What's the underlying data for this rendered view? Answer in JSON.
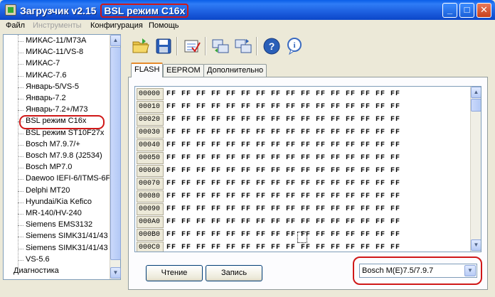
{
  "window": {
    "title_prefix": "Загрузчик v2.15",
    "title_mode": "BSL режим C16x",
    "controls": {
      "minimize": "_",
      "maximize": "□",
      "close": "✕"
    }
  },
  "menu": {
    "items": [
      "Файл",
      "Инструменты",
      "Конфигурация",
      "Помощь"
    ],
    "disabled": [
      "Инструменты"
    ]
  },
  "tree": {
    "items": [
      "МИКАС-11/М73А",
      "МИКАС-11/VS-8",
      "МИКАС-7",
      "МИКАС-7.6",
      "Январь-5/VS-5",
      "Январь-7.2",
      "Январь-7.2+/М73",
      "BSL режим C16x",
      "BSL режим ST10F27x",
      "Bosch M7.9.7/+",
      "Bosch M7.9.8 (J2534)",
      "Bosch MP7.0",
      "Daewoo IEFI-6/ITMS-6F",
      "Delphi MT20",
      "Hyundai/Kia Kefico",
      "MR-140/HV-240",
      "Siemens EMS3132",
      "Siemens SIMK31/41/43",
      "Siemens SIMK31/41/43 |",
      "VS-5.6"
    ],
    "selected": "BSL режим C16x",
    "root_bottom": "Диагностика"
  },
  "toolbar": {
    "icons": [
      "open-folder-icon",
      "save-icon",
      "check-settings-icon",
      "read-ecu-icon",
      "write-ecu-icon",
      "help-icon",
      "info-icon"
    ]
  },
  "tabs": {
    "items": [
      "FLASH",
      "EEPROM",
      "Дополнительно"
    ],
    "active": "FLASH"
  },
  "hex": {
    "rows": [
      {
        "addr": "00000",
        "bytes": "FF FF FF FF FF FF FF FF FF FF FF FF FF FF FF FF"
      },
      {
        "addr": "00010",
        "bytes": "FF FF FF FF FF FF FF FF FF FF FF FF FF FF FF FF"
      },
      {
        "addr": "00020",
        "bytes": "FF FF FF FF FF FF FF FF FF FF FF FF FF FF FF FF"
      },
      {
        "addr": "00030",
        "bytes": "FF FF FF FF FF FF FF FF FF FF FF FF FF FF FF FF"
      },
      {
        "addr": "00040",
        "bytes": "FF FF FF FF FF FF FF FF FF FF FF FF FF FF FF FF"
      },
      {
        "addr": "00050",
        "bytes": "FF FF FF FF FF FF FF FF FF FF FF FF FF FF FF FF"
      },
      {
        "addr": "00060",
        "bytes": "FF FF FF FF FF FF FF FF FF FF FF FF FF FF FF FF"
      },
      {
        "addr": "00070",
        "bytes": "FF FF FF FF FF FF FF FF FF FF FF FF FF FF FF FF"
      },
      {
        "addr": "00080",
        "bytes": "FF FF FF FF FF FF FF FF FF FF FF FF FF FF FF FF"
      },
      {
        "addr": "00090",
        "bytes": "FF FF FF FF FF FF FF FF FF FF FF FF FF FF FF FF"
      },
      {
        "addr": "000A0",
        "bytes": "FF FF FF FF FF FF FF FF FF FF FF FF FF FF FF FF"
      },
      {
        "addr": "000B0",
        "bytes": "FF FF FF FF FF FF FF FF FF FF FF FF FF FF FF FF"
      },
      {
        "addr": "000C0",
        "bytes": "FF FF FF FF FF FF FF FF FF FF FF FF FF FF FF FF"
      }
    ]
  },
  "buttons": {
    "read": "Чтение",
    "write": "Запись"
  },
  "ecu_select": {
    "value": "Bosch M(E)7.5/7.9.7"
  },
  "colors": {
    "title_bar": "#1d5fe0",
    "highlight": "#d01818",
    "active_tab_accent": "#e68b2c"
  }
}
